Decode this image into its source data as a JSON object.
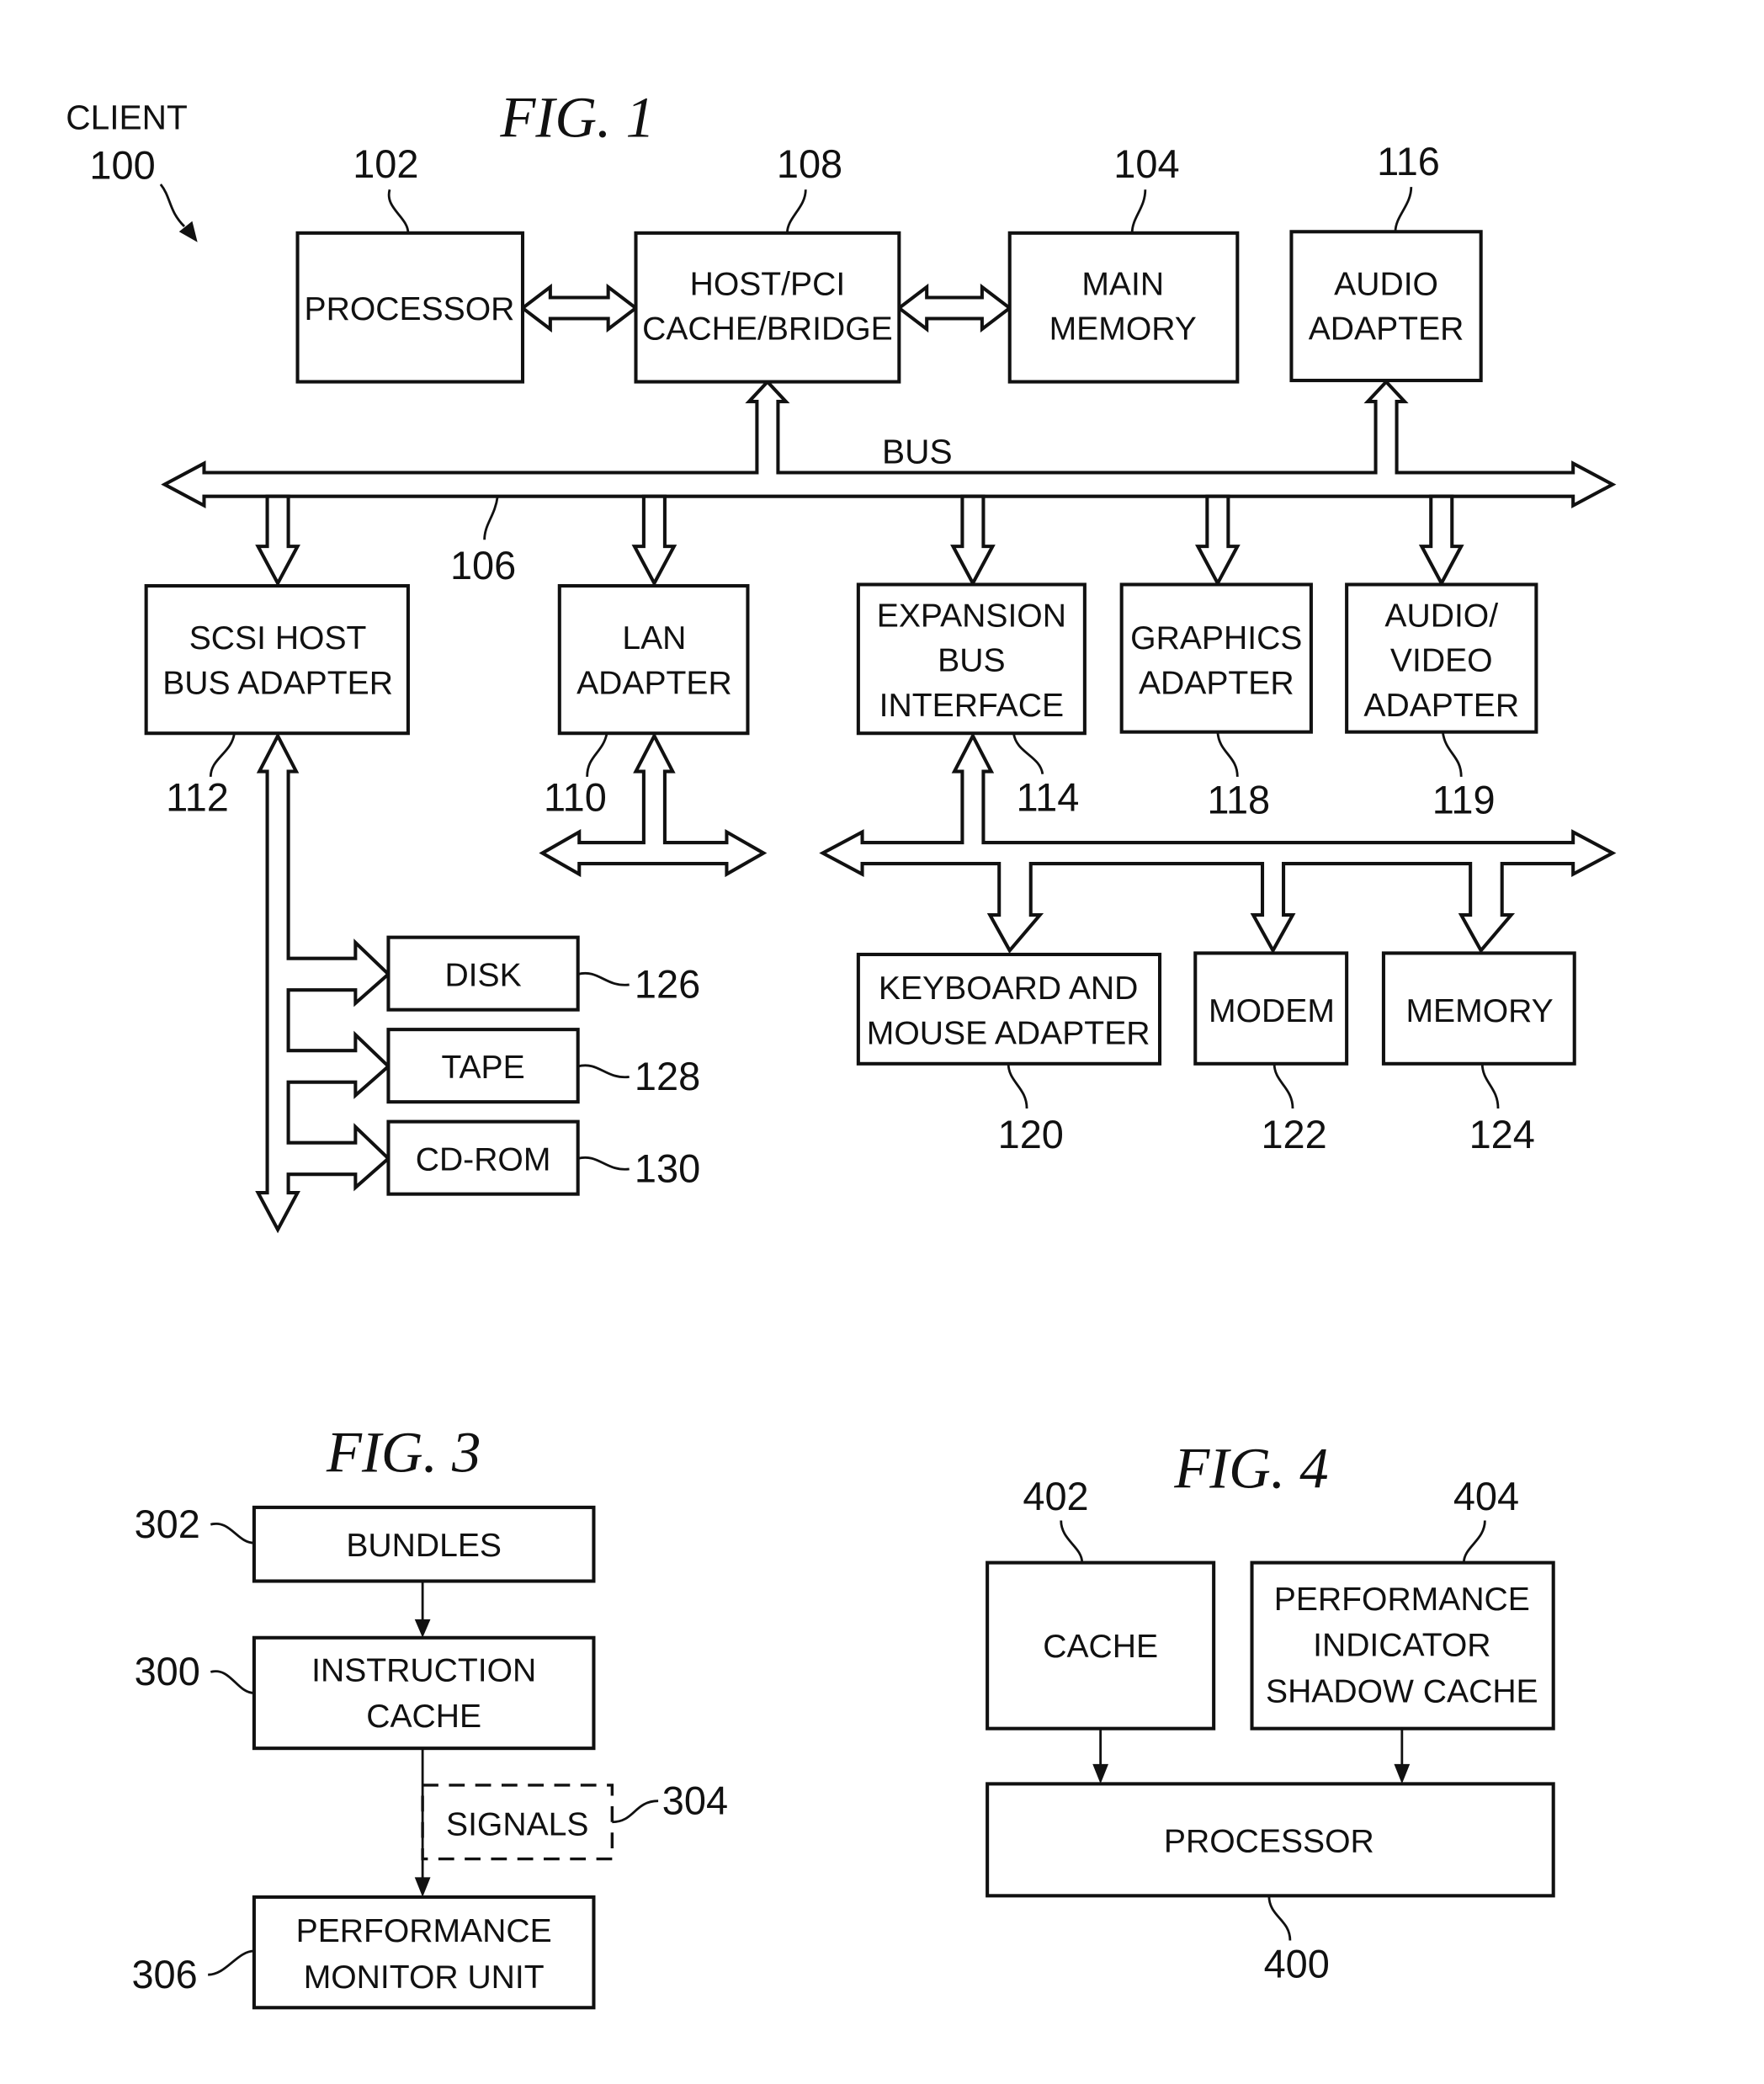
{
  "fig1": {
    "title": "FIG. 1",
    "client_label": "CLIENT",
    "client_ref": "100",
    "bus_label": "BUS",
    "bus_ref": "106",
    "blocks": {
      "processor": {
        "lines": [
          "PROCESSOR"
        ],
        "ref": "102"
      },
      "host_bridge": {
        "lines": [
          "HOST/PCI",
          "CACHE/BRIDGE"
        ],
        "ref": "108"
      },
      "main_memory": {
        "lines": [
          "MAIN",
          "MEMORY"
        ],
        "ref": "104"
      },
      "audio_adapter": {
        "lines": [
          "AUDIO",
          "ADAPTER"
        ],
        "ref": "116"
      },
      "scsi": {
        "lines": [
          "SCSI HOST",
          "BUS ADAPTER"
        ],
        "ref": "112"
      },
      "lan": {
        "lines": [
          "LAN",
          "ADAPTER"
        ],
        "ref": "110"
      },
      "expansion": {
        "lines": [
          "EXPANSION",
          "BUS",
          "INTERFACE"
        ],
        "ref": "114"
      },
      "graphics": {
        "lines": [
          "GRAPHICS",
          "ADAPTER"
        ],
        "ref": "118"
      },
      "av_adapter": {
        "lines": [
          "AUDIO/",
          "VIDEO",
          "ADAPTER"
        ],
        "ref": "119"
      },
      "disk": {
        "lines": [
          "DISK"
        ],
        "ref": "126"
      },
      "tape": {
        "lines": [
          "TAPE"
        ],
        "ref": "128"
      },
      "cdrom": {
        "lines": [
          "CD-ROM"
        ],
        "ref": "130"
      },
      "keyboard": {
        "lines": [
          "KEYBOARD AND",
          "MOUSE ADAPTER"
        ],
        "ref": "120"
      },
      "modem": {
        "lines": [
          "MODEM"
        ],
        "ref": "122"
      },
      "memory": {
        "lines": [
          "MEMORY"
        ],
        "ref": "124"
      }
    }
  },
  "fig3": {
    "title": "FIG. 3",
    "blocks": {
      "bundles": {
        "lines": [
          "BUNDLES"
        ],
        "ref": "302"
      },
      "icache": {
        "lines": [
          "INSTRUCTION",
          "CACHE"
        ],
        "ref": "300"
      },
      "signals": {
        "lines": [
          "SIGNALS"
        ],
        "ref": "304"
      },
      "pmu": {
        "lines": [
          "PERFORMANCE",
          "MONITOR UNIT"
        ],
        "ref": "306"
      }
    }
  },
  "fig4": {
    "title": "FIG. 4",
    "blocks": {
      "cache": {
        "lines": [
          "CACHE"
        ],
        "ref": "402"
      },
      "shadow": {
        "lines": [
          "PERFORMANCE",
          "INDICATOR",
          "SHADOW CACHE"
        ],
        "ref": "404"
      },
      "processor": {
        "lines": [
          "PROCESSOR"
        ],
        "ref": "400"
      }
    }
  }
}
